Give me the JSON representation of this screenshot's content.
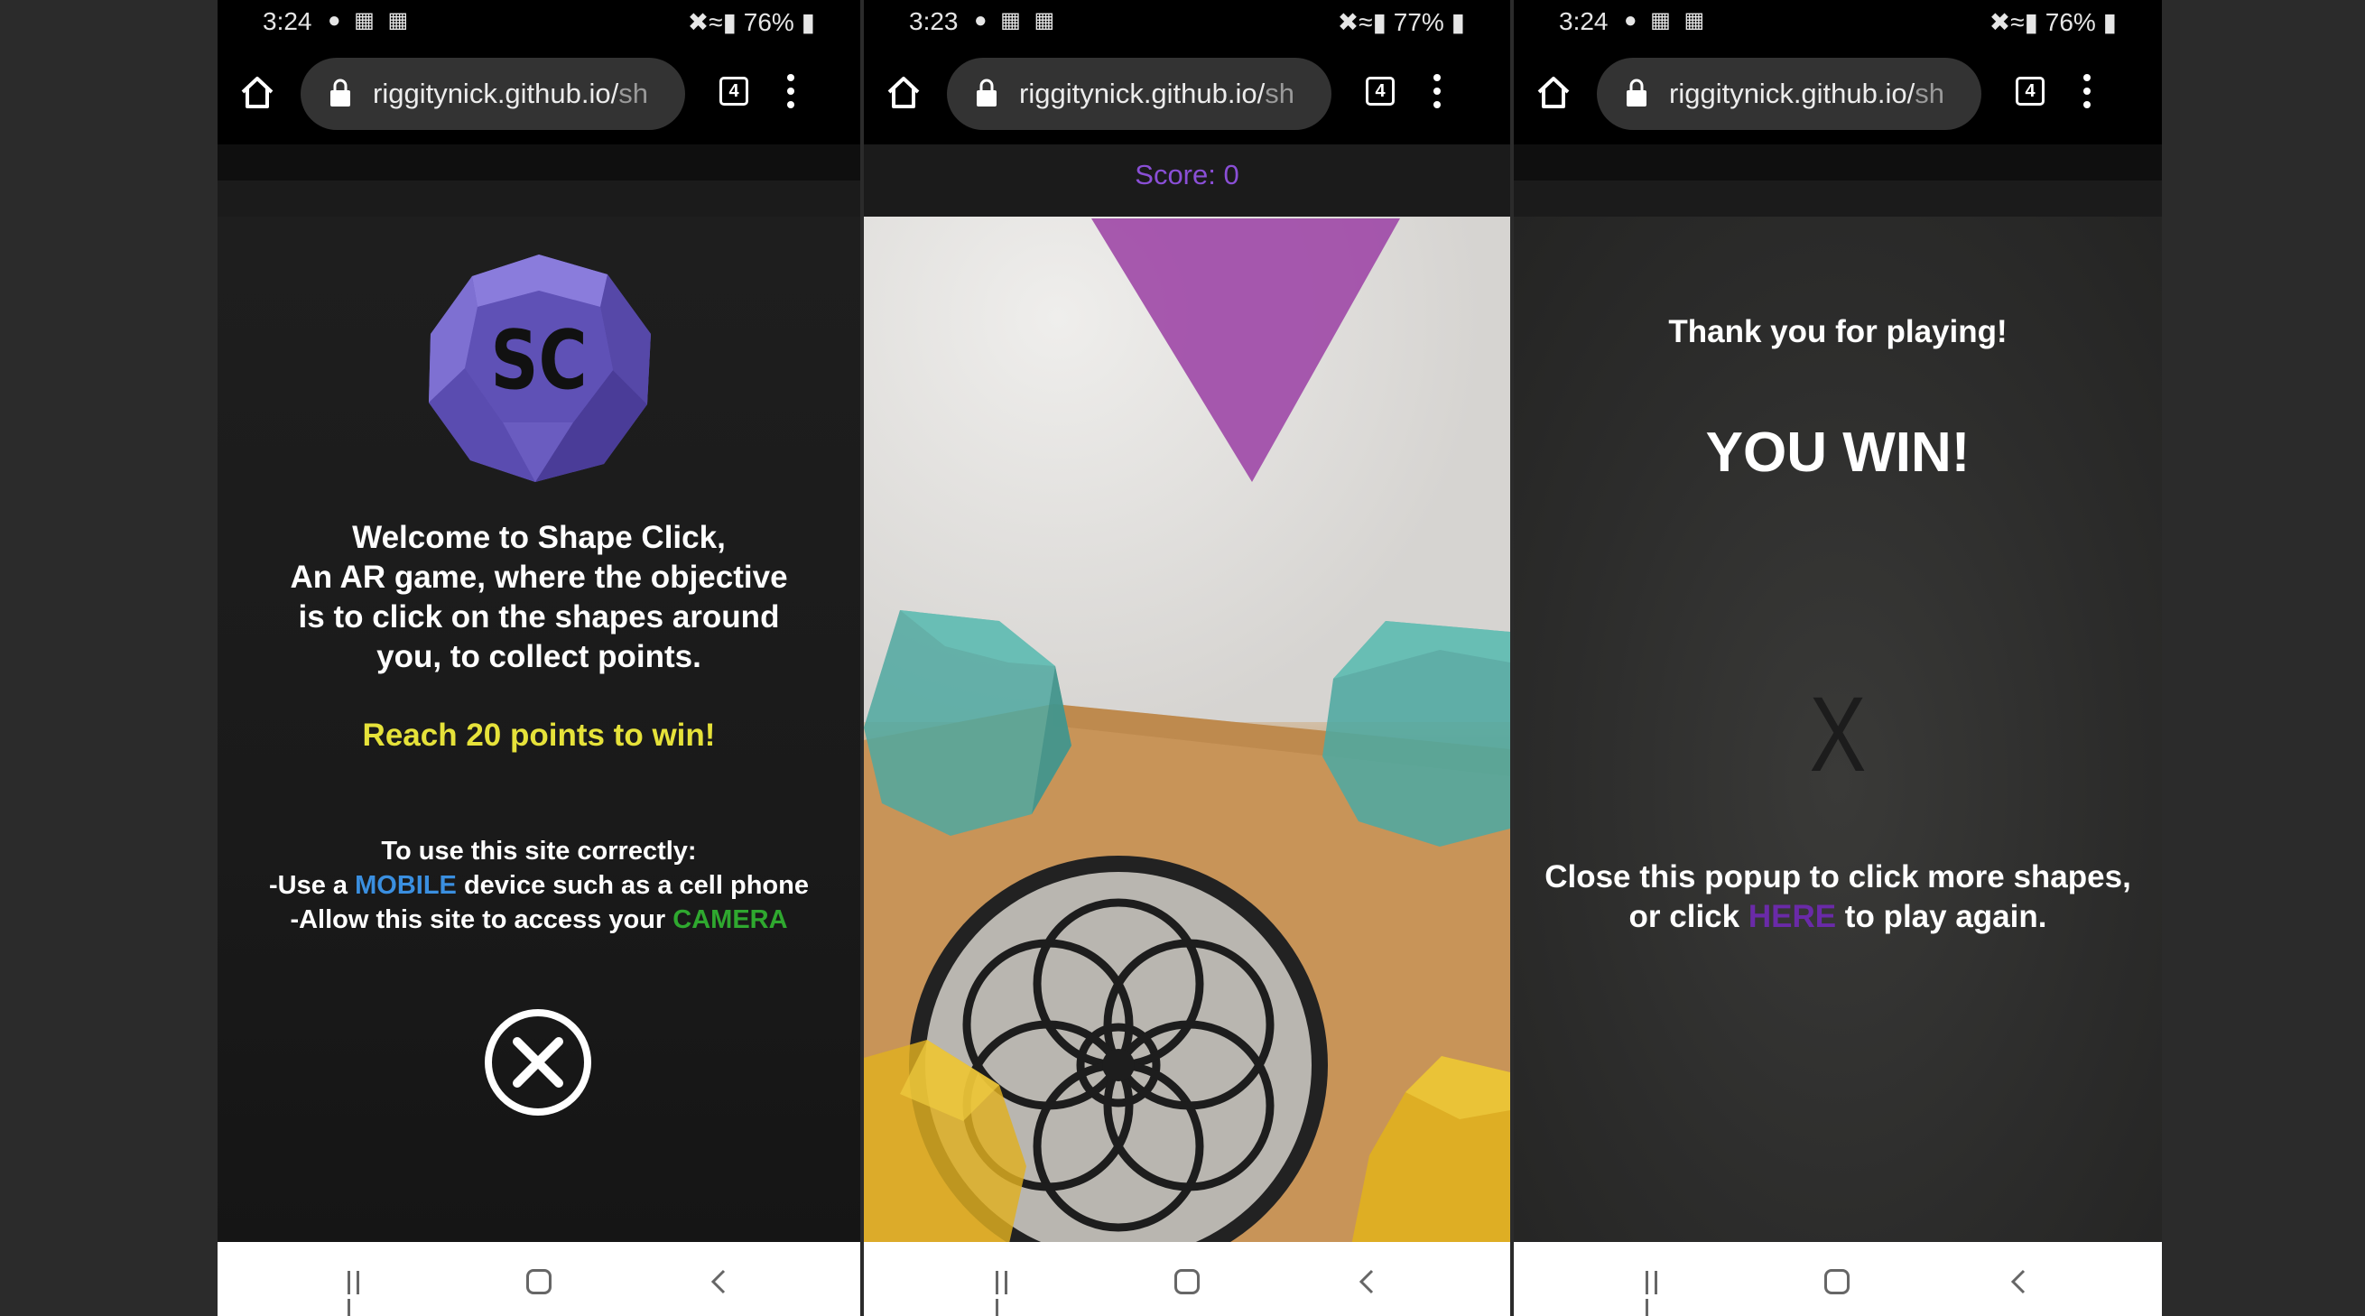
{
  "browser": {
    "url_main": "riggitynick.github.io/",
    "url_faded": "sh",
    "tab_count": "4"
  },
  "screens": [
    {
      "status": {
        "time": "3:24",
        "battery": "76%"
      },
      "intro": {
        "logo_text": "SC",
        "welcome_lines": [
          "Welcome to Shape Click,",
          "An AR game, where the objective",
          "is to click on the shapes around",
          "you, to collect points."
        ],
        "goal": "Reach 20 points to win!",
        "instructions_title": "To use this site correctly:",
        "instr1_pre": "-Use a ",
        "instr1_highlight": "MOBILE",
        "instr1_post": " device such as a cell phone",
        "instr2_pre": "-Allow this site to access your ",
        "instr2_highlight": "CAMERA"
      }
    },
    {
      "status": {
        "time": "3:23",
        "battery": "77%"
      },
      "game": {
        "score_label": "Score: 0"
      }
    },
    {
      "status": {
        "time": "3:24",
        "battery": "76%"
      },
      "win": {
        "thanks": "Thank you for playing!",
        "headline": "YOU WIN!",
        "close_label": "X",
        "footer_line1": "Close this popup to click more shapes,",
        "footer_pre": "or click ",
        "footer_link": "HERE",
        "footer_post": " to play again."
      }
    }
  ],
  "colors": {
    "accent_yellow": "#e6e23a",
    "accent_blue": "#3a8fe0",
    "accent_green": "#2fa82f",
    "accent_purple": "#6a2aa8",
    "score_purple": "#8a4fd6"
  }
}
